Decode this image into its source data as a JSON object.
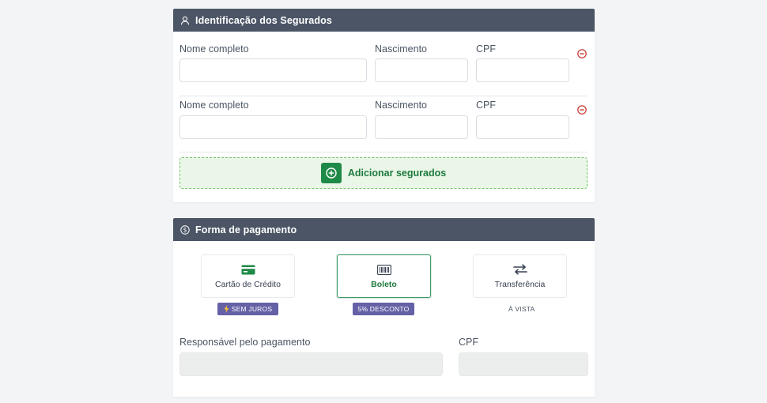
{
  "insured_section": {
    "title": "Identificação dos Segurados",
    "rows": [
      {
        "name_label": "Nome completo",
        "name_value": "",
        "birth_label": "Nascimento",
        "birth_value": "",
        "cpf_label": "CPF",
        "cpf_value": ""
      },
      {
        "name_label": "Nome completo",
        "name_value": "",
        "birth_label": "Nascimento",
        "birth_value": "",
        "cpf_label": "CPF",
        "cpf_value": ""
      }
    ],
    "add_button_label": "Adicionar segurados"
  },
  "payment_section": {
    "title": "Forma de pagamento",
    "options": [
      {
        "label": "Cartão de Crédito",
        "icon": "credit-card-icon",
        "tag": "SEM JUROS",
        "tag_icon": "lightning-icon",
        "selected": false
      },
      {
        "label": "Boleto",
        "icon": "barcode-icon",
        "tag": "5% DESCONTO",
        "selected": true
      },
      {
        "label": "Transferência",
        "icon": "transfer-arrows-icon",
        "tag": "À VISTA",
        "selected": false
      }
    ],
    "responsible_label": "Responsável pelo pagamento",
    "responsible_value": "",
    "cpf_label": "CPF",
    "cpf_value": ""
  },
  "colors": {
    "header_bg": "#4b5566",
    "accent_green": "#1f8a48",
    "badge_purple": "#6461a6",
    "remove_red": "#c53030"
  }
}
